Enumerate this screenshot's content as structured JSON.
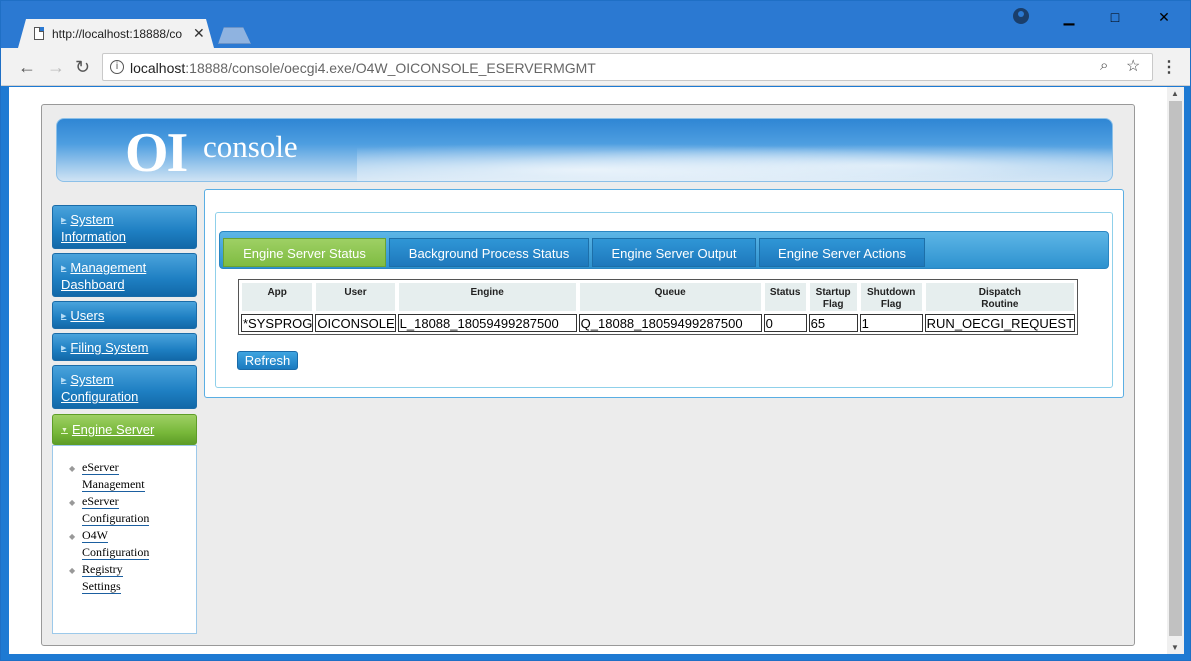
{
  "browser": {
    "tab_title": "http://localhost:18888/co",
    "url_host": "localhost",
    "url_rest": ":18888/console/oecgi4.exe/O4W_OICONSOLE_ESERVERMGMT"
  },
  "banner": {
    "logo_main": "OI",
    "logo_sub": "console"
  },
  "sidebar": {
    "items": [
      {
        "line1": "System",
        "line2": "Information"
      },
      {
        "line1": "Management",
        "line2": "Dashboard"
      },
      {
        "line1": "Users"
      },
      {
        "line1": "Filing System"
      },
      {
        "line1": "System",
        "line2": "Configuration"
      },
      {
        "line1": "Engine Server"
      }
    ],
    "submenu": [
      {
        "line1": "eServer",
        "line2": "Management"
      },
      {
        "line1": "eServer",
        "line2": "Configuration"
      },
      {
        "line1": "O4W",
        "line2": "Configuration"
      },
      {
        "line1": "Registry",
        "line2": "Settings"
      }
    ]
  },
  "tabs": [
    {
      "label": "Engine Server Status"
    },
    {
      "label": "Background Process Status"
    },
    {
      "label": "Engine Server Output"
    },
    {
      "label": "Engine Server Actions"
    }
  ],
  "table": {
    "headers": [
      {
        "l1": "App",
        "l2": ""
      },
      {
        "l1": "User",
        "l2": ""
      },
      {
        "l1": "Engine",
        "l2": ""
      },
      {
        "l1": "Queue",
        "l2": ""
      },
      {
        "l1": "Status",
        "l2": ""
      },
      {
        "l1": "Startup",
        "l2": "Flag"
      },
      {
        "l1": "Shutdown",
        "l2": "Flag"
      },
      {
        "l1": "Dispatch",
        "l2": "Routine"
      }
    ],
    "rows": [
      [
        "*SYSPROG",
        "OICONSOLE",
        "L_18088_18059499287500",
        "Q_18088_18059499287500",
        "0",
        "65",
        "1",
        "RUN_OECGI_REQUEST"
      ]
    ]
  },
  "actions": {
    "refresh_label": "Refresh"
  }
}
